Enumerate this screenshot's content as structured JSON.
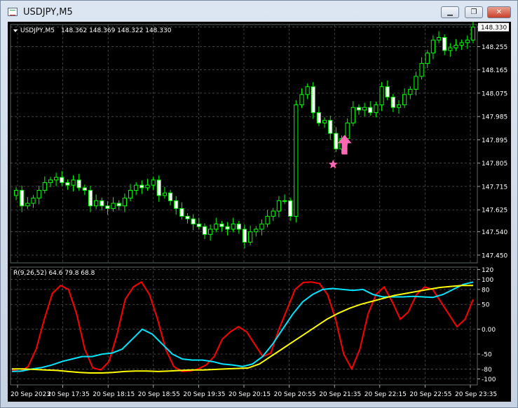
{
  "window": {
    "title": "USDJPY,M5",
    "minimize_label": "▁",
    "maximize_label": "❐",
    "close_label": "✕"
  },
  "header": {
    "symbol": "USDJPY,M5",
    "ohlc": "148.362 148.369 148.322 148.330"
  },
  "indicator": {
    "label": "R(9,26,52) 64.6 79.8 68.8"
  },
  "chart_data": {
    "type": "candlestick",
    "symbol": "USDJPY",
    "timeframe": "M5",
    "current_price": "148.330",
    "price_ticks": [
      "148.330",
      "148.255",
      "148.165",
      "148.075",
      "147.985",
      "147.895",
      "147.805",
      "147.715",
      "147.625",
      "147.540",
      "147.450"
    ],
    "indicator_ticks": [
      "120",
      "100",
      "80",
      "50",
      "0.00",
      "-50",
      "-80",
      "-100"
    ],
    "time_labels": [
      "20 Sep 2023",
      "20 Sep 17:35",
      "20 Sep 18:15",
      "20 Sep 18:55",
      "20 Sep 19:35",
      "20 Sep 20:15",
      "20 Sep 20:55",
      "20 Sep 21:35",
      "20 Sep 22:15",
      "20 Sep 22:55",
      "20 Sep 23:35"
    ],
    "ylim": [
      147.42,
      148.34
    ],
    "indicator_ylim": [
      -112,
      125
    ],
    "closes": [
      147.7,
      147.64,
      147.65,
      147.67,
      147.7,
      147.73,
      147.74,
      147.75,
      147.73,
      147.72,
      147.74,
      147.71,
      147.7,
      147.64,
      147.66,
      147.64,
      147.63,
      147.65,
      147.64,
      147.67,
      147.7,
      147.72,
      147.71,
      147.72,
      147.74,
      147.68,
      147.69,
      147.66,
      147.63,
      147.6,
      147.59,
      147.57,
      147.56,
      147.53,
      147.55,
      147.57,
      147.56,
      147.55,
      147.57,
      147.55,
      147.5,
      147.54,
      147.55,
      147.57,
      147.6,
      147.62,
      147.66,
      147.66,
      147.6,
      148.03,
      148.07,
      148.1,
      148.0,
      147.96,
      147.97,
      147.92,
      147.86,
      147.9,
      147.96,
      148.02,
      148.01,
      148.02,
      148.0,
      148.03,
      148.1,
      148.06,
      148.02,
      148.03,
      148.07,
      148.09,
      148.14,
      148.19,
      148.23,
      148.28,
      148.29,
      148.24,
      148.25,
      148.26,
      148.27,
      148.28,
      148.33
    ],
    "signals": [
      {
        "type": "buy-arrow",
        "color": "#ff69b4"
      },
      {
        "type": "star",
        "color": "#ff69b4"
      }
    ],
    "series": [
      {
        "color": "#ff0000",
        "values": [
          -82,
          -85,
          -75,
          -40,
          20,
          72,
          88,
          80,
          30,
          -40,
          -78,
          -82,
          -65,
          -10,
          60,
          85,
          95,
          70,
          20,
          -40,
          -75,
          -85,
          -84,
          -80,
          -72,
          -55,
          -20,
          -5,
          5,
          -5,
          -30,
          -55,
          -48,
          0,
          40,
          80,
          94,
          95,
          92,
          70,
          20,
          -50,
          -80,
          -40,
          30,
          70,
          85,
          55,
          20,
          35,
          70,
          85,
          80,
          55,
          30,
          5,
          20,
          60
        ]
      },
      {
        "color": "#00e5ff",
        "values": [
          -85,
          -84,
          -80,
          -77,
          -72,
          -65,
          -60,
          -55,
          -55,
          -50,
          -48,
          -40,
          -20,
          0,
          -10,
          -30,
          -50,
          -60,
          -62,
          -62,
          -65,
          -70,
          -72,
          -75,
          -70,
          -55,
          -30,
          0,
          30,
          55,
          70,
          80,
          82,
          80,
          78,
          80,
          70,
          65,
          65,
          65,
          66,
          65,
          64,
          70,
          80,
          90,
          95
        ]
      },
      {
        "color": "#ffff00",
        "values": [
          -80,
          -80,
          -81,
          -82,
          -83,
          -85,
          -87,
          -88,
          -88,
          -87,
          -85,
          -84,
          -84,
          -85,
          -84,
          -83,
          -82,
          -82,
          -81,
          -80,
          -79,
          -78,
          -70,
          -55,
          -40,
          -25,
          -10,
          5,
          20,
          32,
          42,
          50,
          56,
          62,
          68,
          72,
          76,
          80,
          84,
          86,
          88,
          88
        ]
      }
    ]
  }
}
